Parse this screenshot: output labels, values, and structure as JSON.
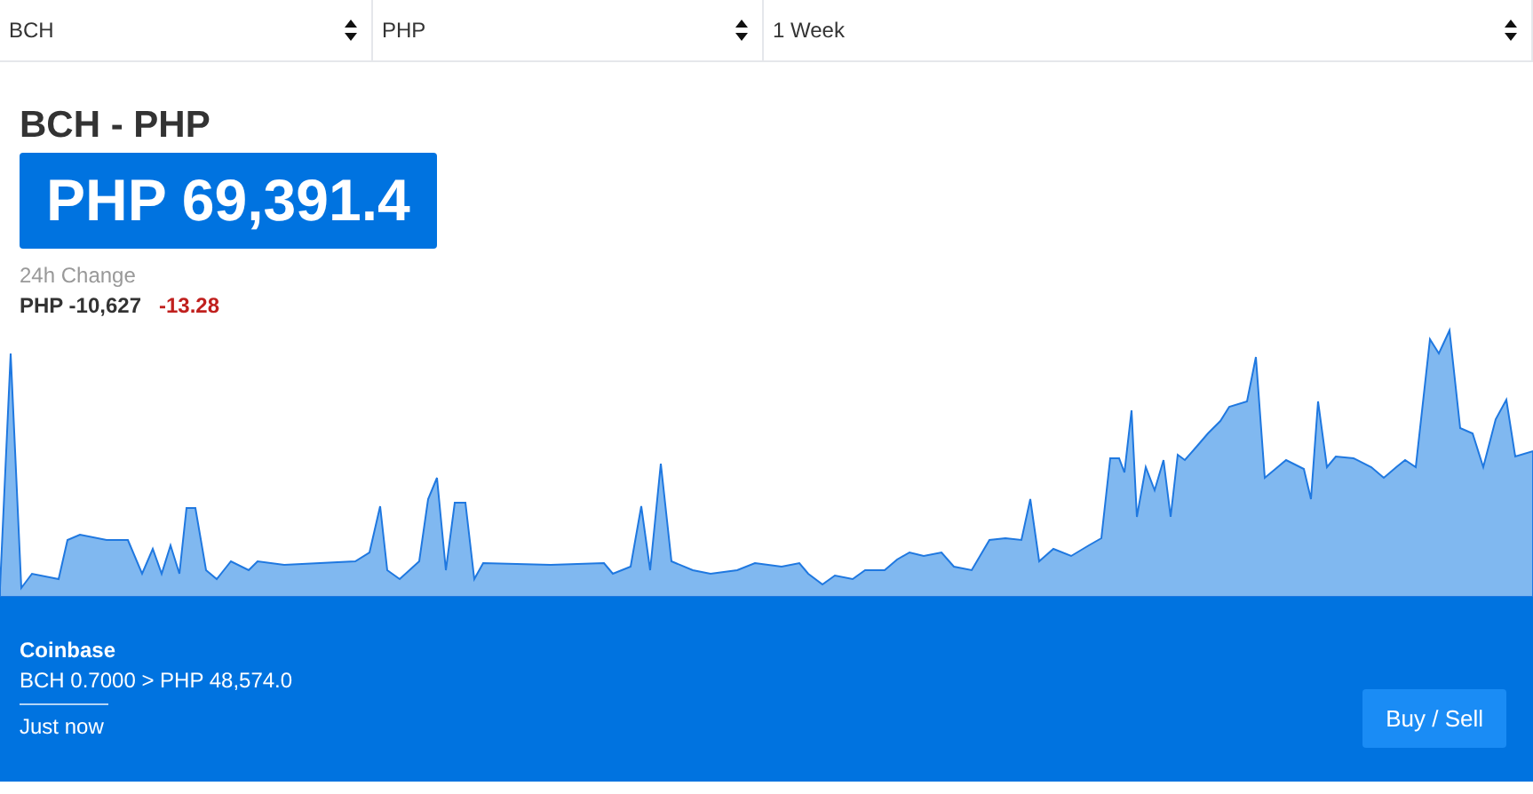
{
  "selects": [
    {
      "value": "BCH"
    },
    {
      "value": "PHP"
    },
    {
      "value": "1 Week"
    }
  ],
  "pair": "BCH - PHP",
  "price": "PHP 69,391.4",
  "change": {
    "label": "24h Change",
    "amount": "PHP -10,627",
    "percent": "-13.28"
  },
  "exchange": {
    "name": "Coinbase",
    "trade": "BCH 0.7000 > PHP 48,574.0",
    "time": "Just now",
    "button": "Buy / Sell"
  }
}
